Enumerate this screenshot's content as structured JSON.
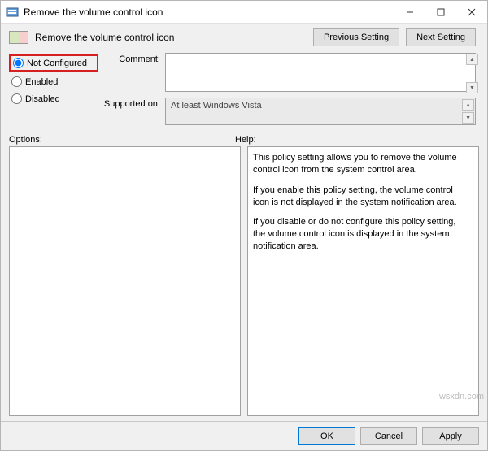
{
  "window": {
    "title": "Remove the volume control icon"
  },
  "header": {
    "setting_name": "Remove the volume control icon",
    "previous_btn": "Previous Setting",
    "next_btn": "Next Setting"
  },
  "state": {
    "not_configured": "Not Configured",
    "enabled": "Enabled",
    "disabled": "Disabled",
    "selected": "not_configured"
  },
  "fields": {
    "comment_label": "Comment:",
    "comment_value": "",
    "supported_label": "Supported on:",
    "supported_value": "At least Windows Vista"
  },
  "sections": {
    "options_label": "Options:",
    "help_label": "Help:"
  },
  "help": {
    "p1": "This policy setting allows you to remove the volume control icon from the system control area.",
    "p2": "If you enable this policy setting, the volume control icon is not displayed in the system notification area.",
    "p3": "If you disable or do not configure this policy setting, the volume control icon is displayed in the system notification area."
  },
  "buttons": {
    "ok": "OK",
    "cancel": "Cancel",
    "apply": "Apply"
  },
  "watermark": "wsxdn.com"
}
